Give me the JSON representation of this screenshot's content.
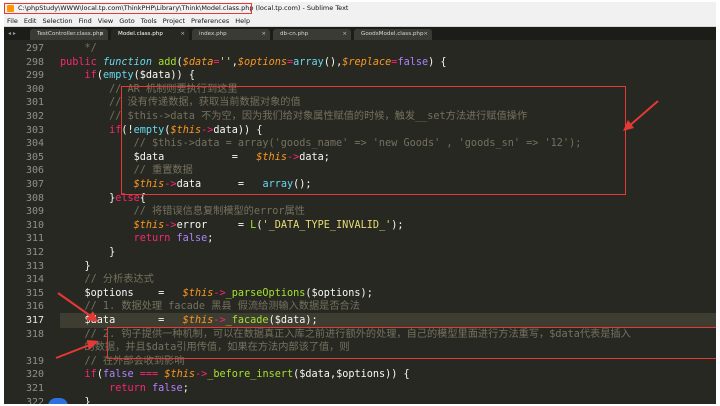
{
  "window": {
    "title": "C:\\phpStudy\\WWW\\local.tp.com\\ThinkPHP\\Library\\Think\\Model.class.php (local.tp.com) - Sublime Text"
  },
  "menu": [
    "File",
    "Edit",
    "Selection",
    "Find",
    "View",
    "Goto",
    "Tools",
    "Project",
    "Preferences",
    "Help"
  ],
  "tabs": [
    {
      "label": "TestController.class.php",
      "active": false
    },
    {
      "label": "Model.class.php",
      "active": true
    },
    {
      "label": "index.php",
      "active": false
    },
    {
      "label": "db-cn.php",
      "active": false
    },
    {
      "label": "GoodsModel.class.php",
      "active": false
    }
  ],
  "tab_nav": "◂ ▸",
  "tab_close": "×",
  "editor": {
    "active_line": 317,
    "line_numbers": [
      "297",
      "298",
      "299",
      "300",
      "301",
      "302",
      "303",
      "304",
      "305",
      "306",
      "307",
      "308",
      "309",
      "310",
      "311",
      "312",
      "313",
      "314",
      "315",
      "316",
      "317",
      "318",
      "",
      "319",
      "320",
      "321",
      "322"
    ],
    "lines": [
      [
        [
          "c",
          "    */"
        ]
      ],
      [
        [
          "k",
          "public "
        ],
        [
          "f",
          "function "
        ],
        [
          "n",
          "add"
        ],
        [
          "p",
          "("
        ],
        [
          "v",
          "$data"
        ],
        [
          "k",
          "="
        ],
        [
          "s",
          "''"
        ],
        [
          "p",
          ","
        ],
        [
          "v",
          "$options"
        ],
        [
          "k",
          "="
        ],
        [
          "t",
          "array"
        ],
        [
          "p",
          "(),"
        ],
        [
          "v",
          "$replace"
        ],
        [
          "k",
          "="
        ],
        [
          "b",
          "false"
        ],
        [
          "p",
          ") {"
        ]
      ],
      [
        [
          "k",
          "    if"
        ],
        [
          "p",
          "("
        ],
        [
          "t",
          "empty"
        ],
        [
          "p",
          "($data)) {"
        ]
      ],
      [
        [
          "c",
          "        // AR 机制则要执行到这里"
        ]
      ],
      [
        [
          "c",
          "        // 没有传递数据，获取当前数据对象的值"
        ]
      ],
      [
        [
          "c",
          "        // $this->data 不为空，因为我们给对象属性赋值的时候，触发__set方法进行赋值操作"
        ]
      ],
      [
        [
          "k",
          "        if"
        ],
        [
          "p",
          "(!"
        ],
        [
          "t",
          "empty"
        ],
        [
          "p",
          "("
        ],
        [
          "v",
          "$this"
        ],
        [
          "k",
          "->"
        ],
        [
          "p",
          "data)) {"
        ]
      ],
      [
        [
          "c",
          "            // $this->data = array('goods_name' => 'new Goods' , 'goods_sn' => '12');"
        ]
      ],
      [
        [
          "p",
          "            $data           =   "
        ],
        [
          "v",
          "$this"
        ],
        [
          "k",
          "->"
        ],
        [
          "p",
          "data;"
        ]
      ],
      [
        [
          "c",
          "            // 重置数据"
        ]
      ],
      [
        [
          "v",
          "            $this"
        ],
        [
          "k",
          "->"
        ],
        [
          "p",
          "data      =   "
        ],
        [
          "t",
          "array"
        ],
        [
          "p",
          "();"
        ]
      ],
      [
        [
          "p",
          "        }"
        ],
        [
          "k",
          "else"
        ],
        [
          "p",
          "{"
        ]
      ],
      [
        [
          "c",
          "            // 将错误信息复制模型的error属性"
        ]
      ],
      [
        [
          "v",
          "            $this"
        ],
        [
          "k",
          "->"
        ],
        [
          "p",
          "error     = "
        ],
        [
          "n",
          "L"
        ],
        [
          "p",
          "("
        ],
        [
          "s",
          "'_DATA_TYPE_INVALID_'"
        ],
        [
          "p",
          ");"
        ]
      ],
      [
        [
          "k",
          "            return "
        ],
        [
          "b",
          "false"
        ],
        [
          "p",
          ";"
        ]
      ],
      [
        [
          "p",
          "        }"
        ]
      ],
      [
        [
          "p",
          "    }"
        ]
      ],
      [
        [
          "c",
          "    // 分析表达式"
        ]
      ],
      [
        [
          "p",
          "    $options    =   "
        ],
        [
          "v",
          "$this"
        ],
        [
          "k",
          "->"
        ],
        [
          "n",
          "_parseOptions"
        ],
        [
          "p",
          "($options);"
        ]
      ],
      [
        [
          "c",
          "    // 1. 数据处理 facade 黑县 假流给测输入数据是否合法"
        ]
      ],
      [
        [
          "p",
          "    $data       =   "
        ],
        [
          "v",
          "$this"
        ],
        [
          "k",
          "->"
        ],
        [
          "n",
          "_facade"
        ],
        [
          "p",
          "($data);"
        ]
      ],
      [
        [
          "c",
          "    // 2. 钩子提供一种机制，可以在数据真正入库之前进行额外的处理，自己的模型里面进行方法重写，$data代表是插入"
        ]
      ],
      [
        [
          "c",
          "    的数据，并且$data引用传值，如果在方法内部该了值，则"
        ]
      ],
      [
        [
          "c",
          "    // 在外部会收到影响"
        ]
      ],
      [
        [
          "k",
          "    if"
        ],
        [
          "p",
          "("
        ],
        [
          "b",
          "false "
        ],
        [
          "k",
          "=== "
        ],
        [
          "v",
          "$this"
        ],
        [
          "k",
          "->"
        ],
        [
          "n",
          "_before_insert"
        ],
        [
          "p",
          "($data,$options)) {"
        ]
      ],
      [
        [
          "k",
          "        return "
        ],
        [
          "b",
          "false"
        ],
        [
          "p",
          ";"
        ]
      ],
      [
        [
          "p",
          "    }"
        ]
      ]
    ]
  }
}
